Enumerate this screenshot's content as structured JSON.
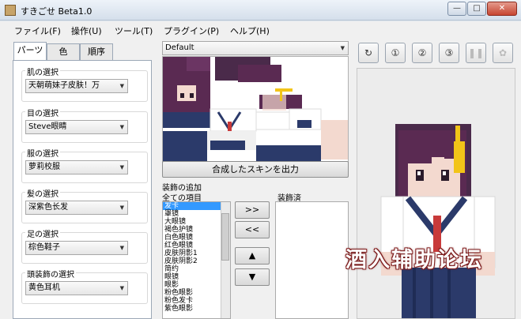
{
  "window": {
    "title": "すきごせ Beta1.0",
    "controls": {
      "minimize": "—",
      "maximize": "□",
      "close": "✕"
    }
  },
  "menu": [
    "ファイル(F)",
    "操作(U)",
    "ツール(T)",
    "プラグイン(P)",
    "ヘルプ(H)"
  ],
  "tabs": [
    {
      "label": "パーツ",
      "active": true
    },
    {
      "label": "色",
      "active": false
    },
    {
      "label": "順序",
      "active": false
    }
  ],
  "parts": [
    {
      "label": "肌の選択",
      "value": "天朝萌妹子皮肤！万"
    },
    {
      "label": "目の選択",
      "value": "Steve眼睛"
    },
    {
      "label": "服の選択",
      "value": "萝莉校服"
    },
    {
      "label": "髪の選択",
      "value": "深紫色长发"
    },
    {
      "label": "足の選択",
      "value": "棕色鞋子"
    },
    {
      "label": "頭装飾の選択",
      "value": "黄色耳机"
    }
  ],
  "preset": {
    "value": "Default"
  },
  "export_button": "合成したスキンを出力",
  "accessories": {
    "section_label": "装飾の追加",
    "all_items_label": "全ての項目",
    "applied_label": "装飾済",
    "all_items": [
      "发卡",
      "罩镜",
      "大眼镜",
      "褐色护镜",
      "白色眼镜",
      "红色眼镜",
      "皮肤阴影1",
      "皮肤阴影2",
      "简约",
      "眼镜",
      "眼影",
      "粉色眼影",
      "粉色发卡",
      "紫色眼影"
    ],
    "selected_index": 0,
    "applied_items": [],
    "add_button": ">>",
    "remove_button": "<<",
    "up_button": "▲",
    "down_button": "▼"
  },
  "toolbar": {
    "buttons": [
      {
        "name": "rotate-icon",
        "glyph": "↻",
        "enabled": true
      },
      {
        "name": "view-1-icon",
        "glyph": "①",
        "enabled": true
      },
      {
        "name": "view-2-icon",
        "glyph": "②",
        "enabled": true
      },
      {
        "name": "view-3-icon",
        "glyph": "③",
        "enabled": true
      },
      {
        "name": "pause-icon",
        "glyph": "❚❚",
        "enabled": false
      },
      {
        "name": "refresh-icon",
        "glyph": "✿",
        "enabled": false
      }
    ]
  },
  "watermark": "酒入辅助论坛",
  "colors": {
    "hair": "#5a2a52",
    "skin": "#f3d9cf",
    "uniform": "#ffffff",
    "skirt": "#2b3a6a",
    "tie": "#c83a3a",
    "headphone": "#f2c418",
    "selection": "#3399ff"
  }
}
